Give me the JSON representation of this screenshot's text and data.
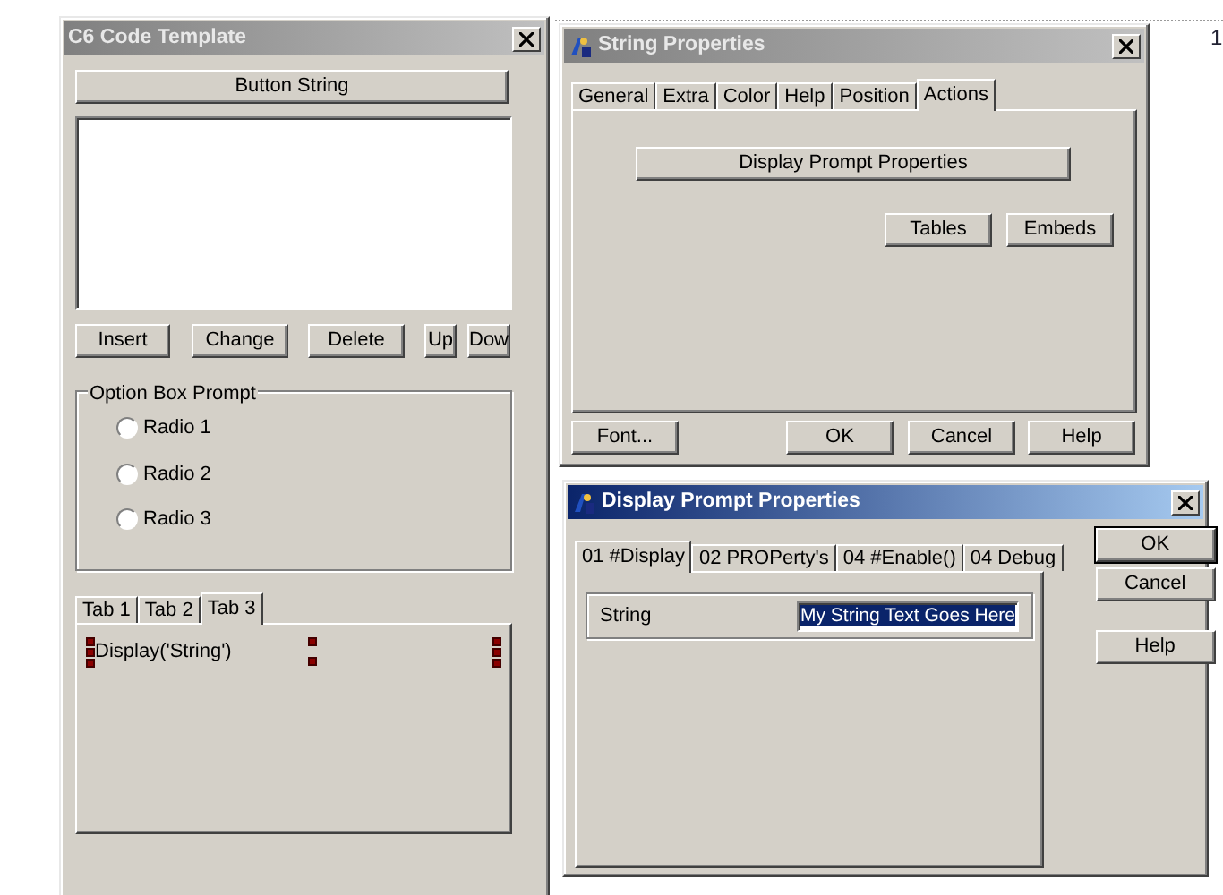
{
  "page_marker": "1",
  "code_template": {
    "title": "C6 Code Template",
    "active": false,
    "button_string": "Button String",
    "buttons": [
      "Insert",
      "Change",
      "Delete",
      "Up",
      "Dow"
    ],
    "option_group": {
      "label": "Option Box Prompt",
      "radios": [
        {
          "label": "Radio 1",
          "selected": false
        },
        {
          "label": "Radio 2",
          "selected": false
        },
        {
          "label": "Radio 3",
          "selected": false
        }
      ]
    },
    "tabs": [
      {
        "label": "Tab 1",
        "selected": false
      },
      {
        "label": "Tab 2",
        "selected": false
      },
      {
        "label": "Tab 3",
        "selected": true
      }
    ],
    "tab_content": "Display('String')"
  },
  "string_properties": {
    "title": "String Properties",
    "active": false,
    "tabs": [
      {
        "label": "General",
        "selected": false
      },
      {
        "label": "Extra",
        "selected": false
      },
      {
        "label": "Color",
        "selected": false
      },
      {
        "label": "Help",
        "selected": false
      },
      {
        "label": "Position",
        "selected": false
      },
      {
        "label": "Actions",
        "selected": true
      }
    ],
    "action_button": "Display Prompt Properties",
    "buttons": [
      "Tables",
      "Embeds"
    ],
    "footer_buttons": [
      "Font...",
      "OK",
      "Cancel",
      "Help"
    ]
  },
  "display_prompt": {
    "title": "Display Prompt Properties",
    "active": true,
    "tabs": [
      {
        "label": "01 #Display",
        "selected": true
      },
      {
        "label": "02 PROPerty's",
        "selected": false
      },
      {
        "label": "04 #Enable()",
        "selected": false
      },
      {
        "label": "04 Debug",
        "selected": false
      }
    ],
    "field": {
      "label": "String",
      "value": "My String Text Goes Here",
      "highlighted": true
    },
    "buttons": [
      {
        "label": "OK",
        "default": true
      },
      {
        "label": "Cancel",
        "default": false
      },
      {
        "label": "Help",
        "default": false
      }
    ]
  }
}
